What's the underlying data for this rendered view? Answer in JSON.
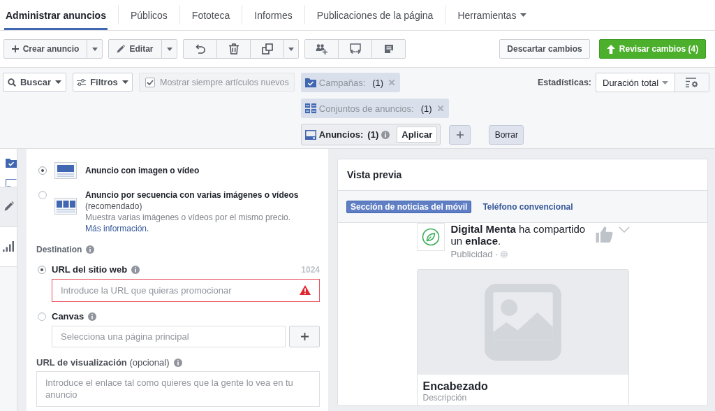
{
  "tabs": [
    {
      "label": "Administrar anuncios",
      "selected": true,
      "dropdown": false
    },
    {
      "label": "Públicos",
      "selected": false,
      "dropdown": false
    },
    {
      "label": "Fototeca",
      "selected": false,
      "dropdown": false
    },
    {
      "label": "Informes",
      "selected": false,
      "dropdown": false
    },
    {
      "label": "Publicaciones de la página",
      "selected": false,
      "dropdown": false
    },
    {
      "label": "Herramientas",
      "selected": false,
      "dropdown": true
    }
  ],
  "toolbar": {
    "create_label": "Crear anuncio",
    "edit_label": "Editar",
    "discard_label": "Descartar cambios",
    "review_label": "Revisar cambios (4)"
  },
  "filters": {
    "search_label": "Buscar",
    "filter_label": "Filtros",
    "show_new": {
      "label": "Mostrar siempre artículos nuevos",
      "checked": true
    },
    "chips": [
      {
        "kind": "campaign",
        "label": "Campañas:",
        "count": "(1)",
        "active": false
      },
      {
        "kind": "adset",
        "label": "Conjuntos de anuncios:",
        "count": "(1)",
        "active": false
      },
      {
        "kind": "ad",
        "label": "Anuncios:",
        "count": "(1)",
        "active": true,
        "apply_label": "Aplicar"
      }
    ],
    "clear_label": "Borrar",
    "stats_label": "Estadísticas:",
    "stats_value": "Duración total"
  },
  "sidebar_tabs": [
    {
      "selected": false
    },
    {
      "selected": true
    },
    {
      "selected": false
    }
  ],
  "ad_formats": [
    {
      "kind": "single",
      "title": "Anuncio con imagen o vídeo",
      "selected": true
    },
    {
      "kind": "carousel",
      "title": "Anuncio por secuencia con varias imágenes o vídeos",
      "note": "(recomendado)",
      "description": "Muestra varias imágenes o vídeos por el mismo precio.",
      "link": "Más información.",
      "selected": false
    }
  ],
  "destination": {
    "label": "Destination",
    "options": [
      {
        "kind": "website",
        "label": "URL del sitio web",
        "counter": "1024",
        "placeholder": "Introduce la URL que quieras promocionar",
        "error": true,
        "selected": true
      },
      {
        "kind": "canvas",
        "label": "Canvas",
        "placeholder": "Selecciona una página principal",
        "error": false,
        "selected": false
      }
    ]
  },
  "display_url": {
    "label": "**URL de visualización** (opcional)",
    "placeholder": "Introduce el enlace tal como quieres que la gente lo vea en tu anuncio"
  },
  "preview": {
    "title": "Vista previa",
    "placements": [
      {
        "label": "Sección de noticias del móvil",
        "selected": true
      },
      {
        "label": "Teléfono convencional",
        "selected": false
      }
    ],
    "post": {
      "text": "**Digital Menta** ha compartido un **enlace**.",
      "meta": "Publicidad ·",
      "headline": "Encabezado",
      "description": "Descripción"
    }
  }
}
